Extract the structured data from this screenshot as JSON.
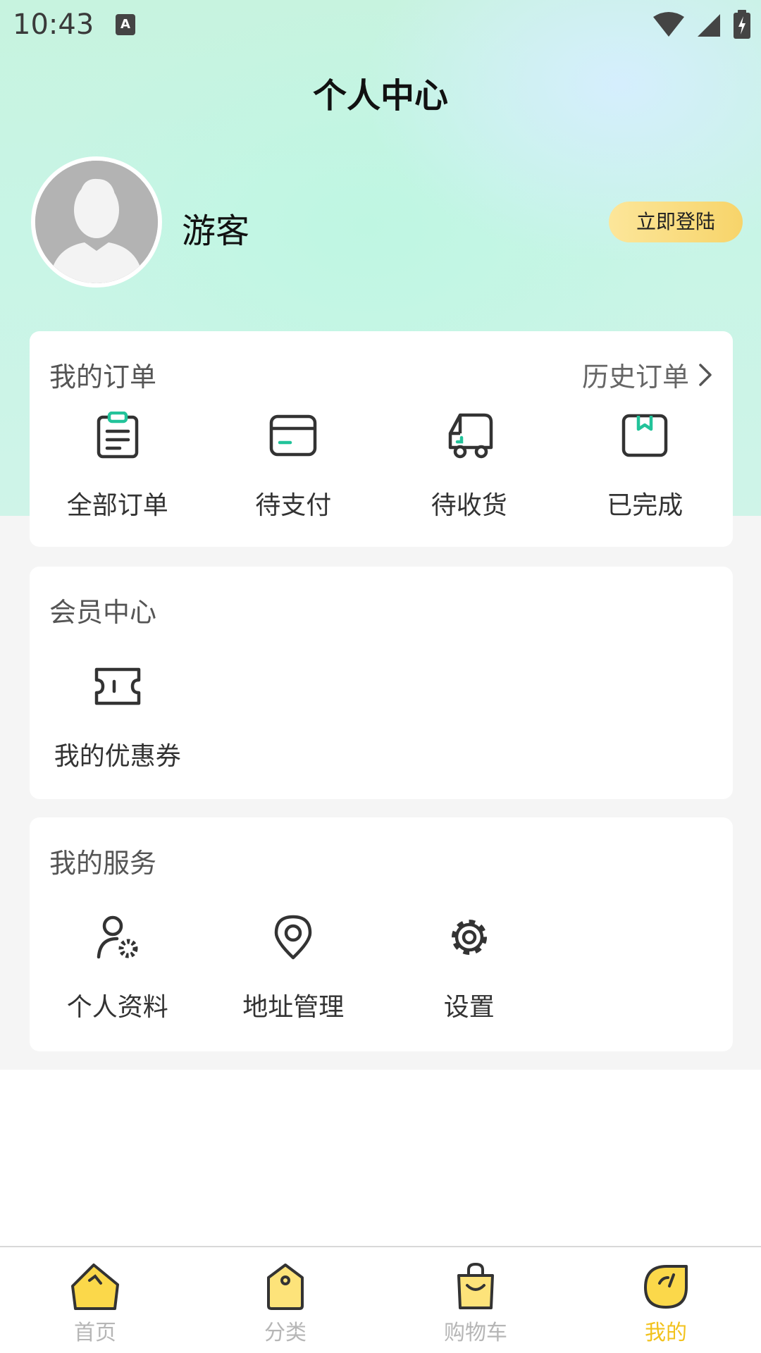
{
  "status_bar": {
    "time": "10:43",
    "indicator_icon": "A"
  },
  "page": {
    "title": "个人中心"
  },
  "profile": {
    "username": "游客",
    "login_button": "立即登陆"
  },
  "orders": {
    "title": "我的订单",
    "history_link": "历史订单",
    "items": [
      {
        "label": "全部订单",
        "icon": "clipboard-icon"
      },
      {
        "label": "待支付",
        "icon": "card-icon"
      },
      {
        "label": "待收货",
        "icon": "truck-icon"
      },
      {
        "label": "已完成",
        "icon": "box-icon"
      }
    ]
  },
  "member": {
    "title": "会员中心",
    "items": [
      {
        "label": "我的优惠券",
        "icon": "ticket-icon"
      }
    ]
  },
  "services": {
    "title": "我的服务",
    "items": [
      {
        "label": "个人资料",
        "icon": "user-settings-icon"
      },
      {
        "label": "地址管理",
        "icon": "location-icon"
      },
      {
        "label": "设置",
        "icon": "gear-icon"
      }
    ]
  },
  "tabbar": {
    "items": [
      {
        "label": "首页",
        "icon": "home-icon"
      },
      {
        "label": "分类",
        "icon": "tag-icon"
      },
      {
        "label": "购物车",
        "icon": "bag-icon"
      },
      {
        "label": "我的",
        "icon": "profile-icon"
      }
    ],
    "active_index": 3
  },
  "colors": {
    "accent_yellow": "#f2c21c",
    "accent_green": "#22c39a",
    "login_button": "#f7d46a",
    "background_gray": "#f5f5f5"
  }
}
